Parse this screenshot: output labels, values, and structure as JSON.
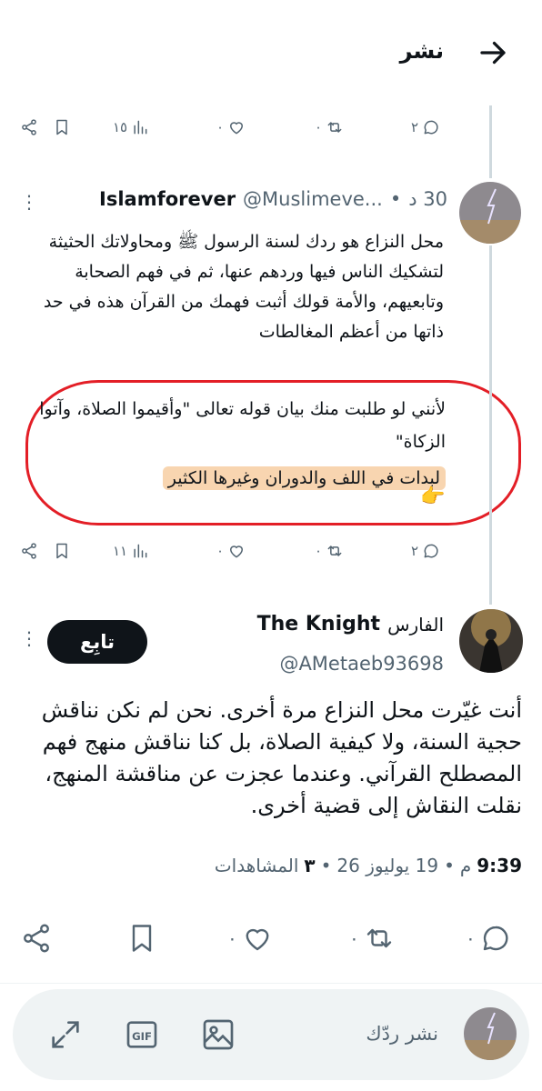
{
  "header": {
    "title": "نشر"
  },
  "parent_actions": {
    "replies": "٢",
    "retweets": "٠",
    "likes": "٠",
    "views": "١٥"
  },
  "parent": {
    "name": "Islamforever",
    "handle": "@Muslimeve...",
    "time": "30 د",
    "text": "محل النزاع هو ردك لسنة الرسول ﷺ ومحاولاتك الحثيثة لتشكيك الناس فيها وردهم عنها، ثم في فهم الصحابة وتابعيهم، والأمة قولك أثبت فهمك من القرآن هذه في حد ذاتها من أعظم المغالطات",
    "text2": "لأنني لو طلبت منك بيان قوله تعالى \"وأقيموا الصلاة، وآتوا الزكاة\"",
    "highlight": "لبدات في اللف والدوران وغيرها الكثير",
    "emoji": "👉"
  },
  "parent_actions2": {
    "replies": "٢",
    "retweets": "٠",
    "likes": "٠",
    "views": "١١"
  },
  "main": {
    "name": "The Knight",
    "name_ar": "الفارس",
    "handle": "@AMetaeb93698",
    "follow_label": "تابِع",
    "text": "أنت غيّرت محل النزاع مرة أخرى. نحن لم نكن نناقش حجية السنة، ولا كيفية الصلاة، بل كنا نناقش منهج فهم المصطلح القرآني. وعندما عجزت عن مناقشة المنهج، نقلت النقاش إلى قضية أخرى.",
    "time": "9:39",
    "ampm": "م",
    "date": "19 يوليوز 26",
    "views_count": "٣",
    "views_label": "المشاهدات"
  },
  "main_actions": {
    "replies": "٠",
    "retweets": "٠",
    "likes": "٠"
  },
  "reply_bar": {
    "placeholder": "نشر ردّك"
  },
  "colors": {
    "text": "#0f1419",
    "secondary": "#536471",
    "highlight": "#f8d5b0",
    "circle": "#e31e26"
  }
}
